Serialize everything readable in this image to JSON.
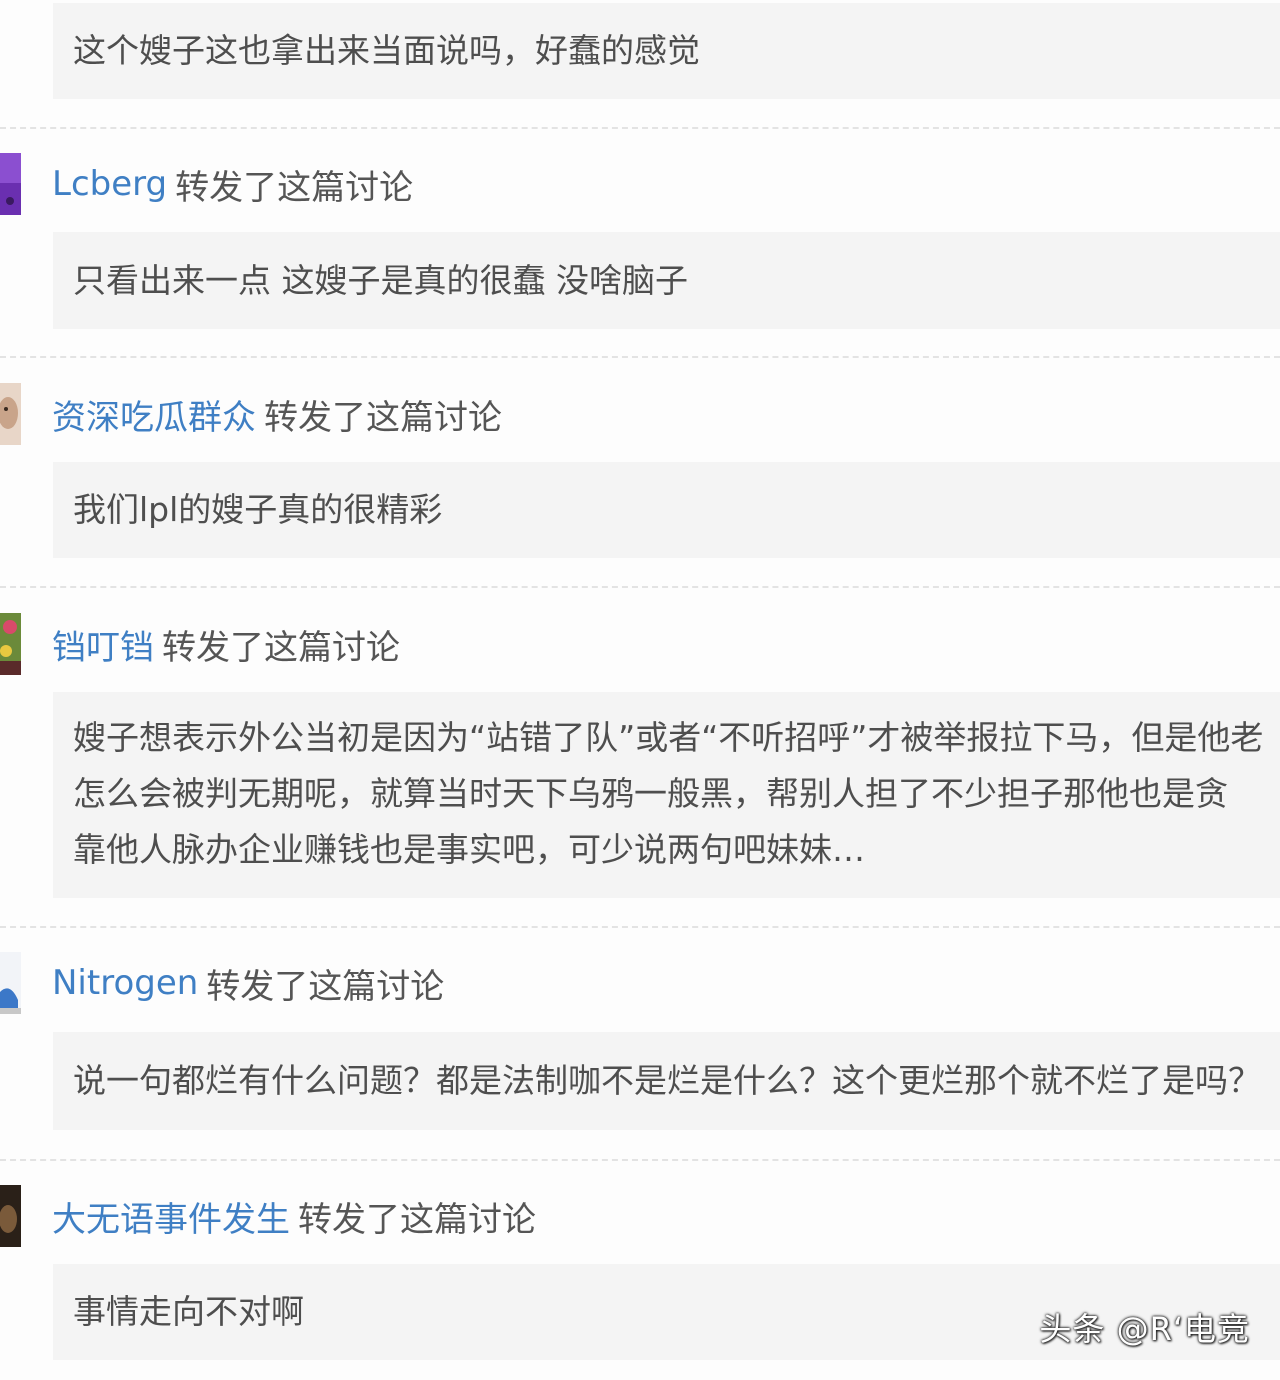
{
  "feed": {
    "first_comment": "这个嫂子这也拿出来当面说吗，好蠢的感觉",
    "entries": [
      {
        "username": "Lcberg",
        "action": "转发了这篇讨论",
        "comment": "只看出来一点 这嫂子是真的很蠢 没啥脑子"
      },
      {
        "username": "资深吃瓜群众",
        "action": "转发了这篇讨论",
        "comment": "我们lpl的嫂子真的很精彩"
      },
      {
        "username": "铛叮铛",
        "action": "转发了这篇讨论",
        "comment": "嫂子想表示外公当初是因为“站错了队”或者“不听招呼”才被举报拉下马，但是他老\n怎么会被判无期呢，就算当时天下乌鸦一般黑，帮别人担了不少担子那他也是贪\n靠他人脉办企业赚钱也是事实吧，可少说两句吧妹妹…"
      },
      {
        "username": "Nitrogen",
        "action": "转发了这篇讨论",
        "comment": "说一句都烂有什么问题？都是法制咖不是烂是什么？这个更烂那个就不烂了是吗？"
      },
      {
        "username": "大无语事件发生",
        "action": "转发了这篇讨论",
        "comment": "事情走向不对啊"
      }
    ]
  },
  "watermark": "头条 @R‘电竞"
}
